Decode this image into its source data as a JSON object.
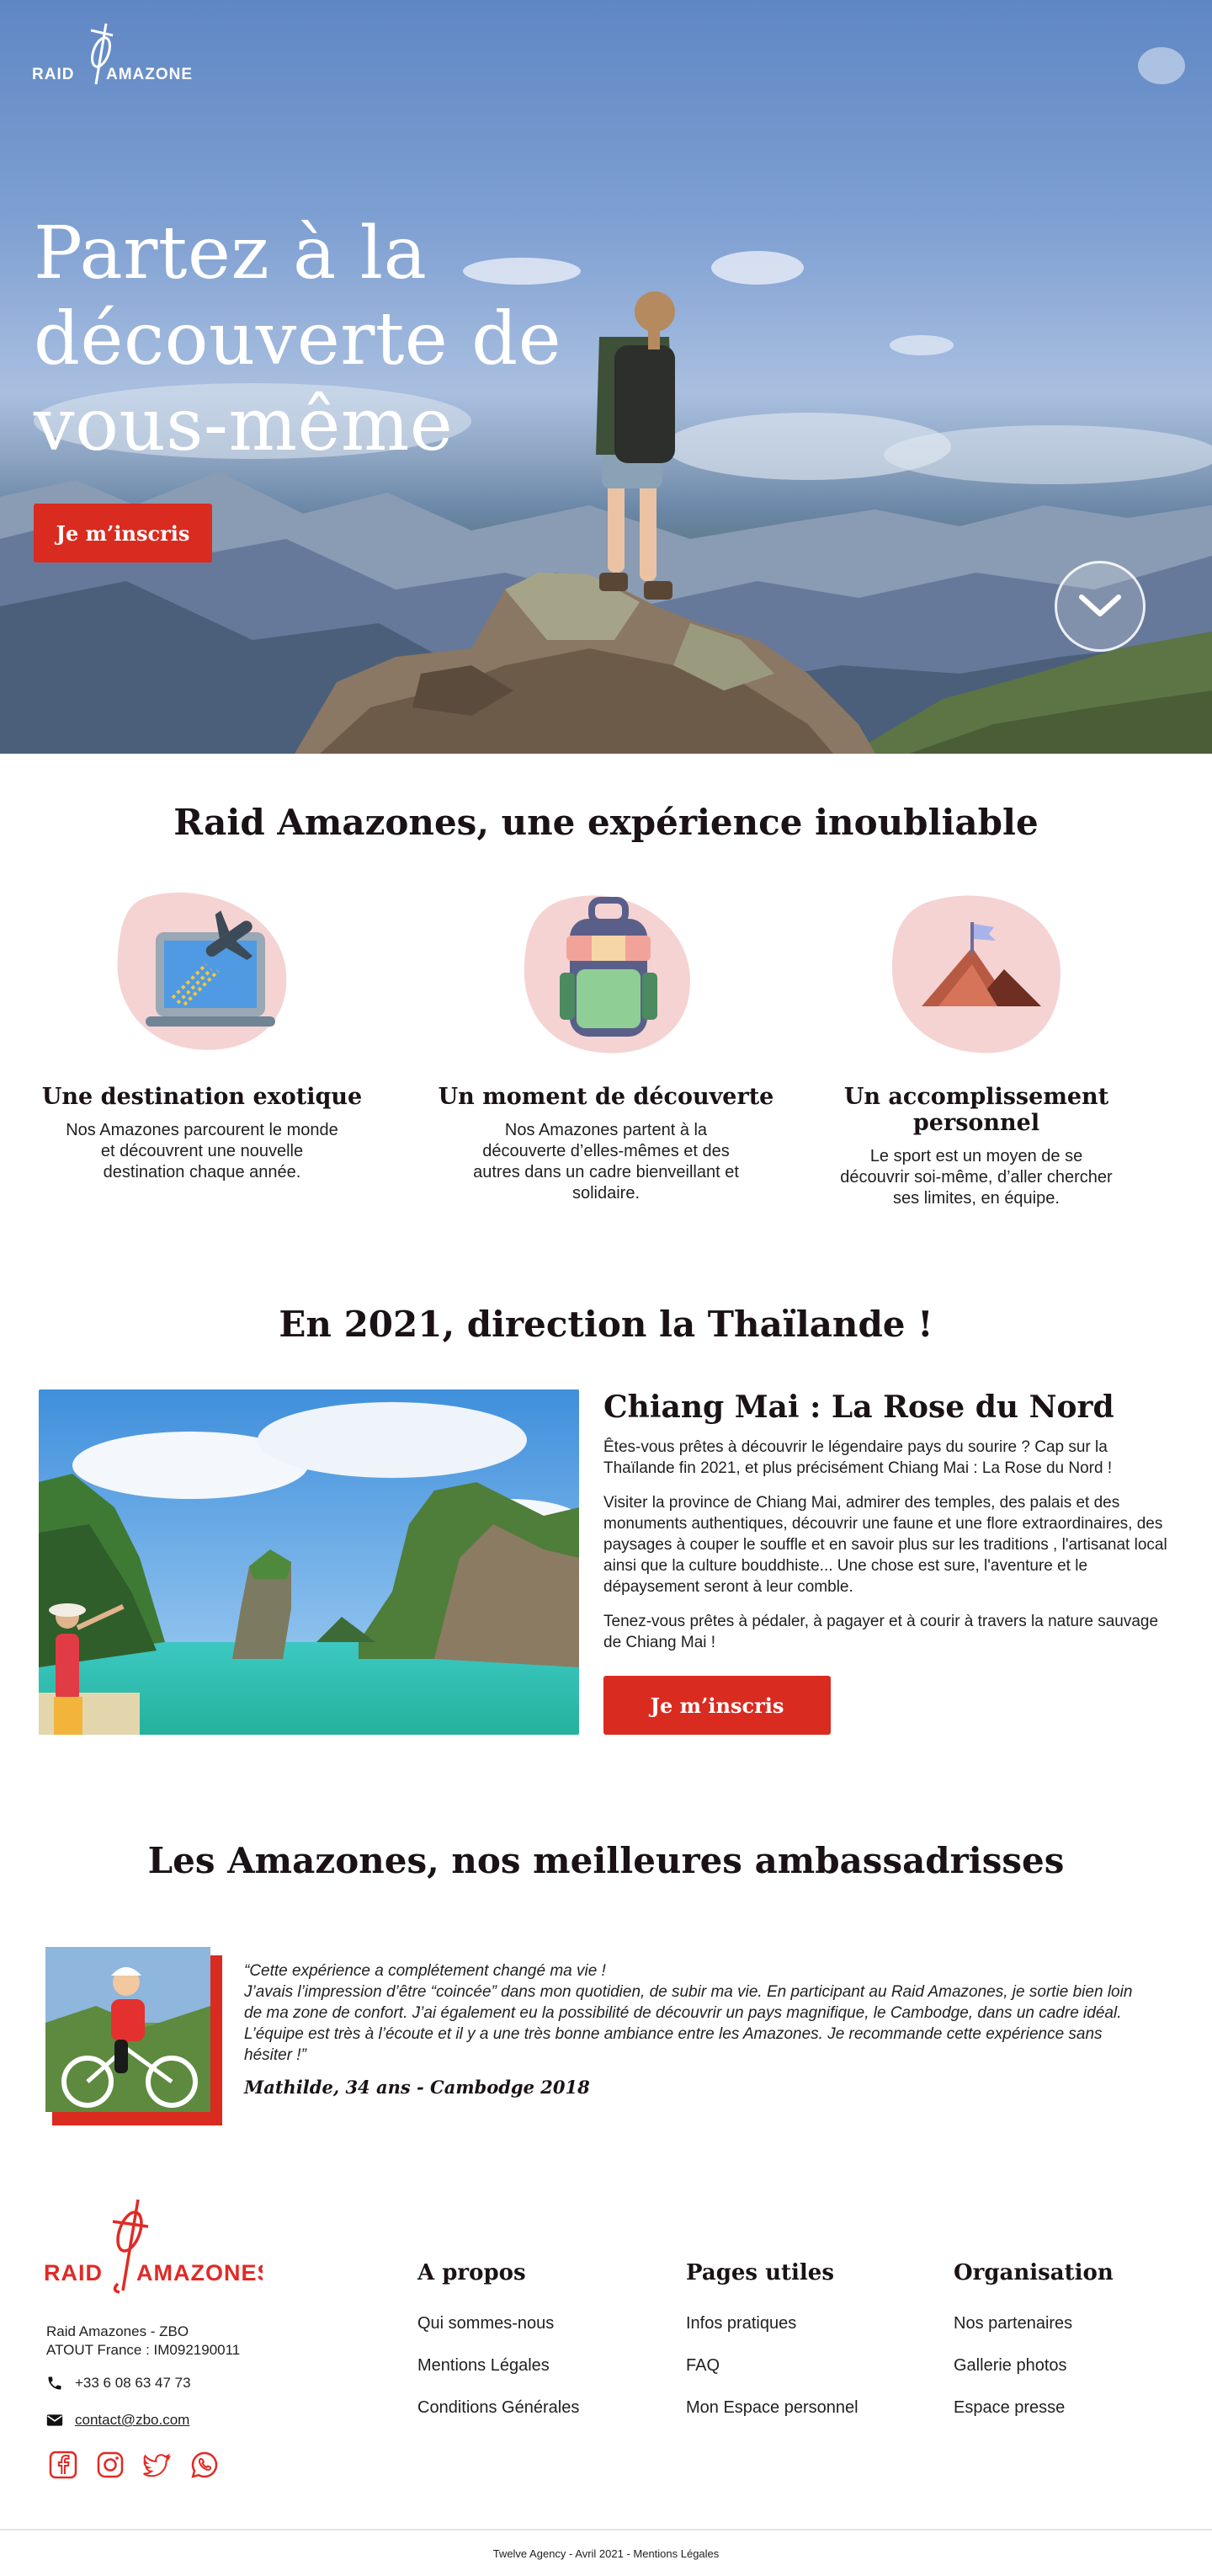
{
  "hero": {
    "logo_text": "RAID AMAZONES",
    "title": "Partez à la découverte de vous-même",
    "cta_label": "Je m’inscris",
    "scroll_icon": "chevron-down-icon"
  },
  "experience": {
    "title": "Raid Amazones, une expérience inoubliable",
    "features": [
      {
        "icon": "laptop-plane-icon",
        "title": "Une destination exotique",
        "text": "Nos Amazones parcourent le monde et découvrent une nouvelle destination chaque année."
      },
      {
        "icon": "backpack-icon",
        "title": "Un moment de découverte",
        "text": "Nos Amazones partent à la découverte d’elles-mêmes et des autres dans un cadre bienveillant et solidaire."
      },
      {
        "icon": "mountain-flag-icon",
        "title": "Un accomplissement personnel",
        "text": "Le sport est un moyen de se découvrir soi-même, d’aller chercher ses limites, en équipe."
      }
    ]
  },
  "thailande": {
    "title": "En 2021, direction la Thaïlande !",
    "subtitle": "Chiang Mai : La Rose du Nord",
    "paragraphs": [
      "Êtes-vous prêtes à découvrir le légendaire pays du sourire ? Cap sur la Thaïlande fin 2021, et plus précisément Chiang Mai : La Rose du Nord !",
      "Visiter la province de Chiang Mai, admirer des temples, des palais et des monuments authentiques, découvrir une faune et une flore extraordinaires, des paysages à couper le souffle et en savoir plus sur les traditions , l'artisanat local ainsi que la culture bouddhiste... Une chose est sure, l'aventure et le dépaysement seront à leur comble.",
      "Tenez-vous prêtes à pédaler, à pagayer et à courir à travers la nature sauvage de Chiang Mai !"
    ],
    "cta_label": "Je m’inscris"
  },
  "ambassadrices": {
    "title": "Les Amazones, nos meilleures ambassadrisses",
    "quote_lines": [
      "“Cette expérience a complétement changé ma vie !",
      "J’avais l’impression d’être “coincée” dans mon quotidien, de subir ma vie. En participant au Raid Amazones, je sortie bien loin de ma zone de confort. J’ai également eu la possibilité de découvrir un pays magnifique, le Cambodge, dans un cadre idéal. L’équipe est très à l’écoute et il y a une très bonne ambiance entre les Amazones. Je recommande cette expérience sans hésiter !”"
    ],
    "author": "Mathilde, 34 ans - Cambodge 2018"
  },
  "footer": {
    "logo_text": "RAID AMAZONES",
    "org_line1": "Raid Amazones - ZBO",
    "org_line2": "ATOUT France : IM092190011",
    "phone": "+33 6 08 63 47 73",
    "email": "contact@zbo.com",
    "columns": [
      {
        "title": "A propos",
        "links": [
          "Qui sommes-nous",
          "Mentions Légales",
          "Conditions Générales"
        ]
      },
      {
        "title": "Pages utiles",
        "links": [
          "Infos pratiques",
          "FAQ",
          "Mon Espace personnel"
        ]
      },
      {
        "title": "Organisation",
        "links": [
          "Nos partenaires",
          "Gallerie photos",
          "Espace presse"
        ]
      }
    ],
    "socials": [
      "facebook-icon",
      "instagram-icon",
      "twitter-icon",
      "whatsapp-icon"
    ],
    "legal": "Twelve Agency - Avril 2021 - Mentions Légales"
  },
  "colors": {
    "accent": "#d92b20",
    "blob": "#f5d3d3",
    "heading": "#1a1216"
  }
}
